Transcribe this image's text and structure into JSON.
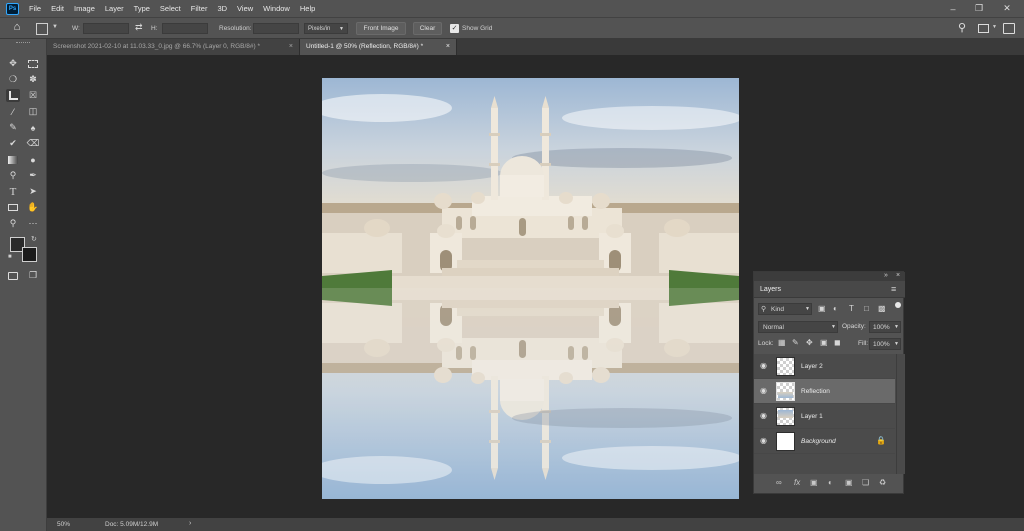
{
  "app": {
    "logo_text": "Ps"
  },
  "menu": [
    "File",
    "Edit",
    "Image",
    "Layer",
    "Type",
    "Select",
    "Filter",
    "3D",
    "View",
    "Window",
    "Help"
  ],
  "options": {
    "w_label": "W:",
    "h_label": "H:",
    "resolution_label": "Resolution:",
    "units_value": "Pixels/in",
    "front_image_label": "Front Image",
    "clear_label": "Clear",
    "show_grid_label": "Show Grid",
    "show_grid_checked": true
  },
  "tabs": [
    {
      "label": "Screenshot 2021-02-10 at 11.03.33_0.jpg @ 66.7% (Layer 0, RGB/8#) *",
      "active": false
    },
    {
      "label": "Untitled-1 @ 50% (Reflection, RGB/8#) *",
      "active": true
    }
  ],
  "status": {
    "zoom": "50%",
    "doc": "Doc: 5.09M/12.9M"
  },
  "layers_panel": {
    "title": "Layers",
    "filter_kind": "Kind",
    "blend_mode": "Normal",
    "opacity_label": "Opacity:",
    "opacity_value": "100%",
    "lock_label": "Lock:",
    "fill_label": "Fill:",
    "fill_value": "100%",
    "layers": [
      {
        "name": "Layer 2",
        "visible": true,
        "selected": false
      },
      {
        "name": "Reflection",
        "visible": true,
        "selected": true
      },
      {
        "name": "Layer 1",
        "visible": true,
        "selected": false
      },
      {
        "name": "Background",
        "visible": true,
        "selected": false,
        "locked": true
      }
    ]
  },
  "colors": {
    "accent": "#31a8ff",
    "panel": "#535353",
    "workspace": "#282828"
  }
}
